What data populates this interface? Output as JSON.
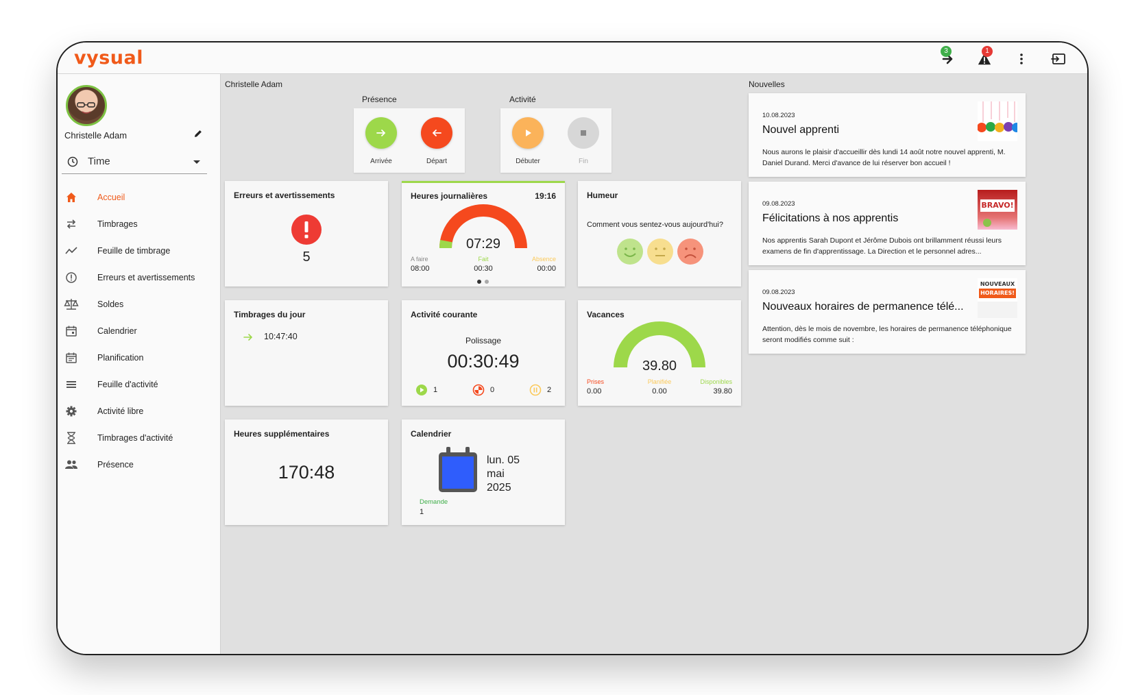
{
  "app": {
    "logo": "vysual"
  },
  "topbar": {
    "notif_count": "3",
    "alert_count": "1"
  },
  "user": {
    "name": "Christelle Adam"
  },
  "selector": {
    "label": "Time"
  },
  "nav": [
    {
      "label": "Accueil",
      "icon": "home-icon",
      "active": true
    },
    {
      "label": "Timbrages",
      "icon": "swap-icon"
    },
    {
      "label": "Feuille de timbrage",
      "icon": "trending-icon"
    },
    {
      "label": "Erreurs et avertissements",
      "icon": "alert-circle-icon"
    },
    {
      "label": "Soldes",
      "icon": "balance-scale-icon"
    },
    {
      "label": "Calendrier",
      "icon": "calendar-icon"
    },
    {
      "label": "Planification",
      "icon": "calendar-planning-icon"
    },
    {
      "label": "Feuille d'activité",
      "icon": "list-icon"
    },
    {
      "label": "Activité libre",
      "icon": "gear-icon"
    },
    {
      "label": "Timbrages d'activité",
      "icon": "hourglass-icon"
    },
    {
      "label": "Présence",
      "icon": "people-icon"
    }
  ],
  "main": {
    "header": "Christelle Adam",
    "presence": {
      "title": "Présence",
      "arrive": "Arrivée",
      "depart": "Départ"
    },
    "activite": {
      "title": "Activité",
      "start": "Débuter",
      "end": "Fin"
    }
  },
  "cards": {
    "errors": {
      "title": "Erreurs et avertissements",
      "count": "5"
    },
    "daily": {
      "title": "Heures journalières",
      "time": "19:16",
      "value": "07:29",
      "progress": 0.06,
      "todo_label": "A faire",
      "todo": "08:00",
      "done_label": "Fait",
      "done": "00:30",
      "absence_label": "Absence",
      "absence": "00:00"
    },
    "mood": {
      "title": "Humeur",
      "question": "Comment vous sentez-vous aujourd'hui?"
    },
    "stamps": {
      "title": "Timbrages du jour",
      "time": "10:47:40"
    },
    "activity": {
      "title": "Activité courante",
      "name": "Polissage",
      "timer": "00:30:49",
      "running": "1",
      "paused": "0",
      "pending": "2"
    },
    "vacation": {
      "title": "Vacances",
      "value": "39.80",
      "taken_label": "Prises",
      "taken": "0.00",
      "planned_label": "Planifiée",
      "planned": "0.00",
      "available_label": "Disponibles",
      "available": "39.80"
    },
    "overtime": {
      "title": "Heures supplémentaires",
      "value": "170:48"
    },
    "calendar": {
      "title": "Calendrier",
      "day": "lun. 05",
      "month": "mai",
      "year": "2025",
      "request_label": "Demande",
      "request_value": "1"
    }
  },
  "news": {
    "title": "Nouvelles",
    "items": [
      {
        "date": "10.08.2023",
        "title": "Nouvel apprenti",
        "body": "Nous aurons le plaisir d'accueillir dès lundi 14 août notre nouvel apprenti, M. Daniel Durand. Merci d'avance de lui réserver bon accueil !"
      },
      {
        "date": "09.08.2023",
        "title": "Félicitations à nos apprentis",
        "body": "Nos apprentis Sarah Dupont et Jérôme Dubois ont brillamment réussi leurs examens de fin d'apprentissage. La Direction et le personnel adres...",
        "thumb_text": "BRAVO!"
      },
      {
        "date": "09.08.2023",
        "title": "Nouveaux horaires de permanence télé...",
        "body": "Attention, dès le mois de novembre, les horaires de permanence téléphonique seront modifiés comme suit :",
        "thumb_text_1": "NOUVEAUX",
        "thumb_text_2": "HORAIRES!"
      }
    ]
  },
  "colors": {
    "accent": "#f05a1a",
    "green": "#9dd84a",
    "orange_red": "#f5491e",
    "peach": "#fbb35a",
    "grey": "#bdbdbd"
  }
}
